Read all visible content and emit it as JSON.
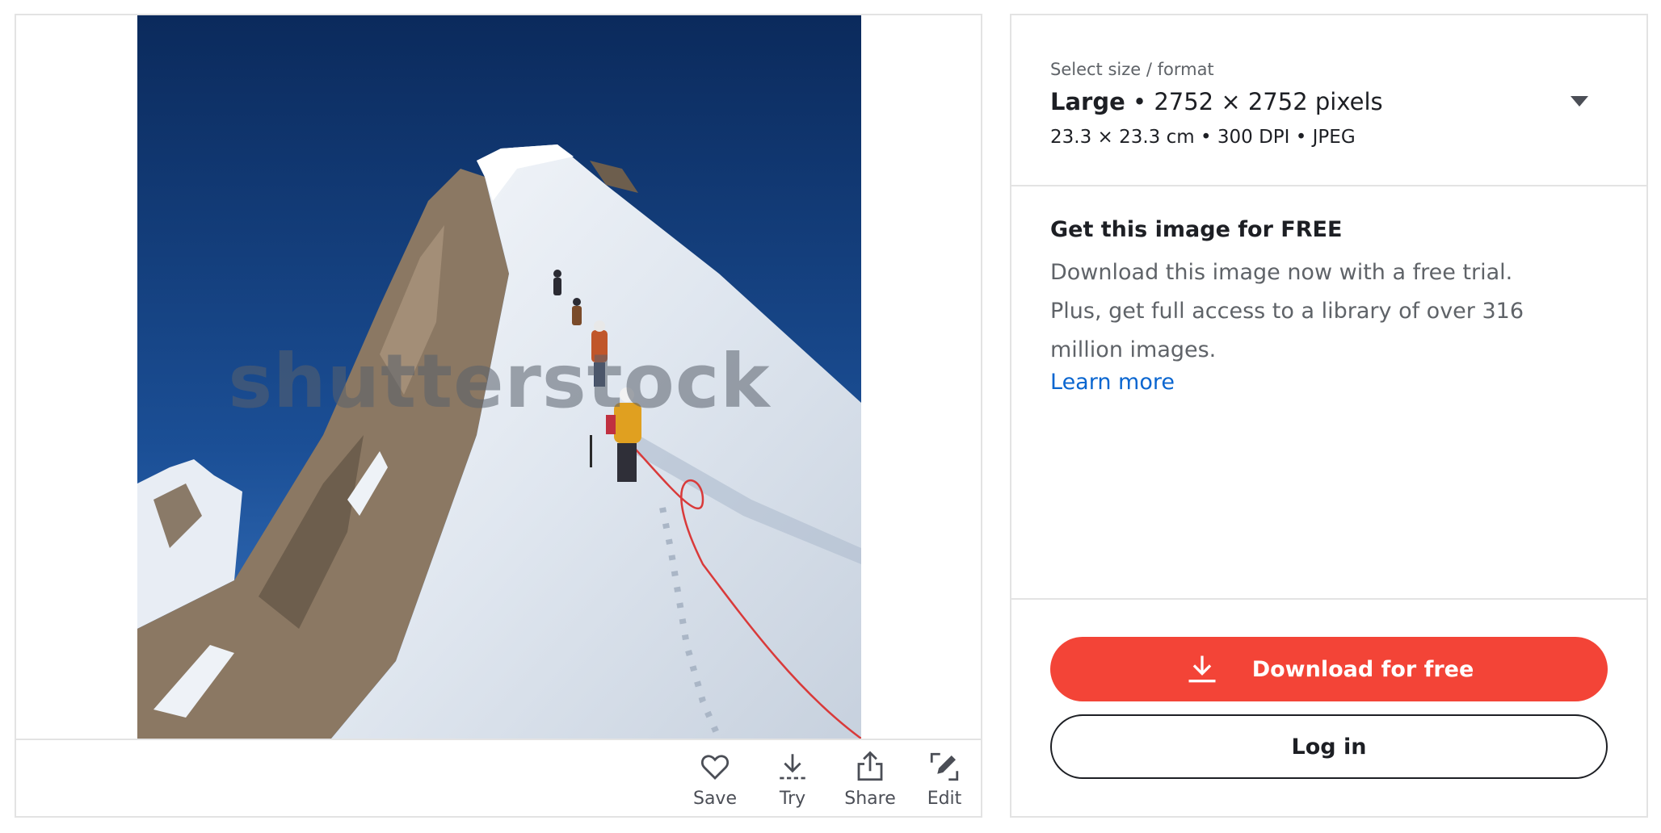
{
  "image": {
    "watermark": "shutterstock",
    "alt_subject": "mountain-ridge-climbers-photo"
  },
  "actions": [
    {
      "label": "Save",
      "icon": "heart-icon"
    },
    {
      "label": "Try",
      "icon": "download-icon"
    },
    {
      "label": "Share",
      "icon": "share-icon"
    },
    {
      "label": "Edit",
      "icon": "edit-icon"
    }
  ],
  "size_selector": {
    "eyebrow": "Select size / format",
    "size_name": "Large",
    "dimensions": " • 2752 × 2752 pixels",
    "detail": "23.3 × 23.3 cm • 300 DPI • JPEG"
  },
  "promo": {
    "title": "Get this image for FREE",
    "text": "Download this image now with a free trial. Plus, get full access to a library of over 316 million images.",
    "link": "Learn more"
  },
  "buttons": {
    "download": "Download for free",
    "login": "Log in"
  },
  "colors": {
    "accent": "#f34437",
    "link": "#0a66d0",
    "border": "#e3e3e3"
  }
}
